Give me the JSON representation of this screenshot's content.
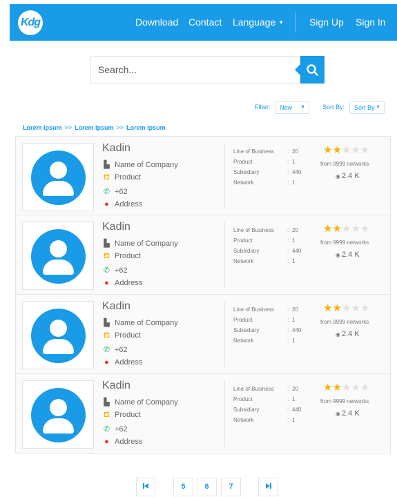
{
  "header": {
    "logo_text": "Kdg",
    "nav": {
      "download": "Download",
      "contact": "Contact",
      "language": "Language",
      "sign_up": "Sign Up",
      "sign_in": "Sign In"
    }
  },
  "search": {
    "placeholder": "Search...",
    "value": ""
  },
  "filters": {
    "filter_label": "Filter:",
    "filter_value": "New",
    "sort_label": "Sort By:",
    "sort_value": "Sort By"
  },
  "breadcrumb": {
    "items": [
      "Lorem Ipsum",
      "Lorem Ipsum",
      "Lorem Ipsum"
    ],
    "separator": ">>"
  },
  "stat_labels": {
    "line_of_business": "Line of Business",
    "product": "Product",
    "subsidiary": "Subsidiary",
    "network": "Network"
  },
  "results": [
    {
      "name": "Kadin",
      "company": "Name of Company",
      "product": "Product",
      "phone": "+62",
      "address": "Address",
      "line_of_business": "20",
      "product_count": "1",
      "subsidiary": "440",
      "network": "1",
      "rating": 2,
      "rating_max": 5,
      "networks_text": "from 9999 networks",
      "views": "2.4 K"
    },
    {
      "name": "Kadin",
      "company": "Name of Company",
      "product": "Product",
      "phone": "+62",
      "address": "Address",
      "line_of_business": "20",
      "product_count": "1",
      "subsidiary": "440",
      "network": "1",
      "rating": 2,
      "rating_max": 5,
      "networks_text": "from 9999 networks",
      "views": "2.4 K"
    },
    {
      "name": "Kadin",
      "company": "Name of Company",
      "product": "Product",
      "phone": "+62",
      "address": "Address",
      "line_of_business": "20",
      "product_count": "1",
      "subsidiary": "440",
      "network": "1",
      "rating": 2,
      "rating_max": 5,
      "networks_text": "from 9999 networks",
      "views": "2.4 K"
    },
    {
      "name": "Kadin",
      "company": "Name of Company",
      "product": "Product",
      "phone": "+62",
      "address": "Address",
      "line_of_business": "20",
      "product_count": "1",
      "subsidiary": "440",
      "network": "1",
      "rating": 2,
      "rating_max": 5,
      "networks_text": "from 9999 networks",
      "views": "2.4 K"
    }
  ],
  "pagination": {
    "first_icon": "first-page-icon",
    "last_icon": "last-page-icon",
    "pages": [
      "5",
      "6",
      "7"
    ]
  },
  "colors": {
    "brand": "#1a9be8",
    "star": "#f5b400",
    "phone": "#1bb35a",
    "address": "#e3342f"
  }
}
